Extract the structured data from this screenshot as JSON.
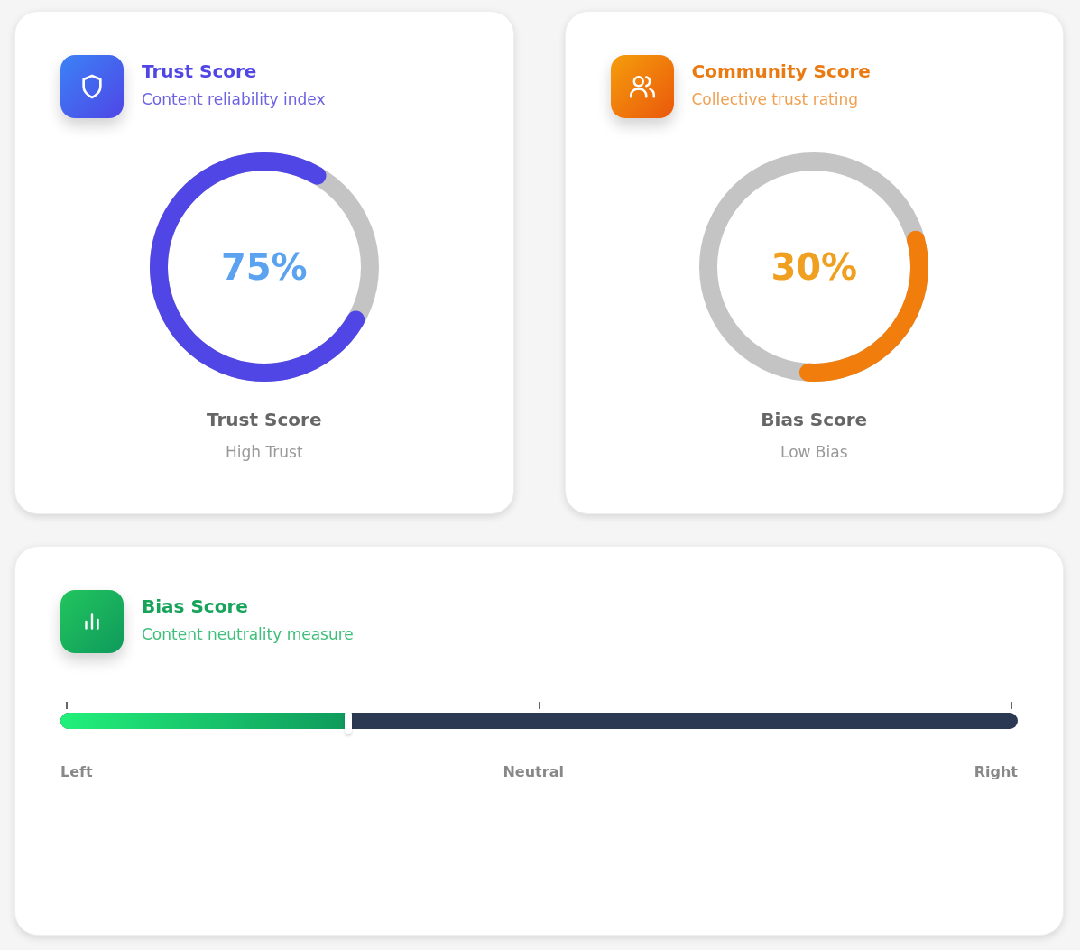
{
  "gauges": [
    {
      "kind": "trust",
      "title": "Trust Score",
      "subtitle": "Content reliability index",
      "reading": "75%",
      "level": 0.75,
      "label": "Trust Score",
      "status": "High Trust"
    },
    {
      "kind": "community",
      "title": "Community Score",
      "subtitle": "Collective trust rating",
      "reading": "30%",
      "level": 0.3,
      "label": "Bias Score",
      "status": "Low Bias"
    }
  ],
  "bias": {
    "title": "Bias Score",
    "subtitle": "Content neutrality measure",
    "level": 0.3,
    "scale": [
      "Left",
      "Neutral",
      "Right"
    ]
  }
}
